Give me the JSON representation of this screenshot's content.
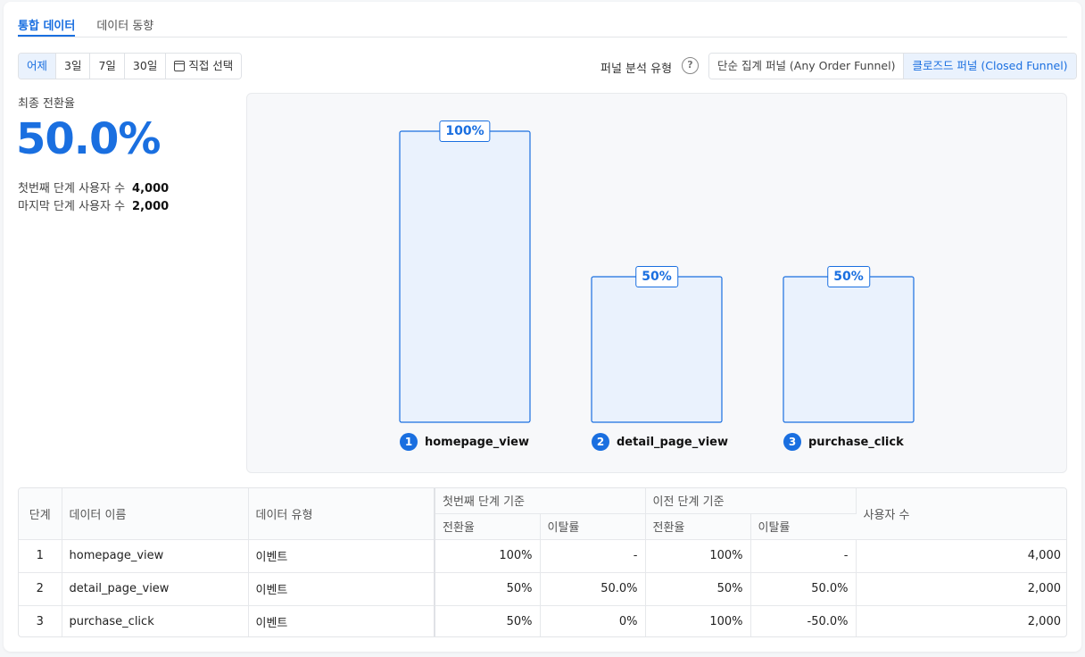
{
  "tabs": [
    {
      "label": "통합 데이터",
      "active": true
    },
    {
      "label": "데이터 동향",
      "active": false
    }
  ],
  "range": {
    "options": [
      "어제",
      "3일",
      "7일",
      "30일"
    ],
    "custom_label": "직접 선택",
    "active_index": 0
  },
  "funnel_type": {
    "label": "퍼널 분석 유형",
    "help_icon": "?",
    "options": [
      "단순 집계 퍼널 (Any Order Funnel)",
      "클로즈드 퍼널 (Closed Funnel)"
    ],
    "active_index": 1
  },
  "summary": {
    "label": "최종 전환율",
    "value": "50.0%",
    "first_label": "첫번째 단계 사용자 수",
    "first_value": "4,000",
    "last_label": "마지막 단계 사용자 수",
    "last_value": "2,000"
  },
  "chart_data": {
    "type": "bar",
    "categories": [
      "homepage_view",
      "detail_page_view",
      "purchase_click"
    ],
    "steps": [
      "1",
      "2",
      "3"
    ],
    "values": [
      100,
      50,
      50
    ],
    "labels": [
      "100%",
      "50%",
      "50%"
    ],
    "ylim": [
      0,
      100
    ],
    "colors": {
      "fill": "#eaf2fd",
      "stroke": "#1a6fe0"
    }
  },
  "table": {
    "headers": {
      "step": "단계",
      "name": "데이터 이름",
      "type": "데이터 유형",
      "first_group": "첫번째 단계 기준",
      "prev_group": "이전 단계 기준",
      "conv": "전환율",
      "drop": "이탈률",
      "users": "사용자 수"
    },
    "rows": [
      {
        "step": "1",
        "name": "homepage_view",
        "type": "이벤트",
        "first_conv": "100%",
        "first_drop": "-",
        "prev_conv": "100%",
        "prev_drop": "-",
        "users": "4,000"
      },
      {
        "step": "2",
        "name": "detail_page_view",
        "type": "이벤트",
        "first_conv": "50%",
        "first_drop": "50.0%",
        "prev_conv": "50%",
        "prev_drop": "50.0%",
        "users": "2,000"
      },
      {
        "step": "3",
        "name": "purchase_click",
        "type": "이벤트",
        "first_conv": "50%",
        "first_drop": "0%",
        "prev_conv": "100%",
        "prev_drop": "-50.0%",
        "users": "2,000"
      }
    ]
  }
}
